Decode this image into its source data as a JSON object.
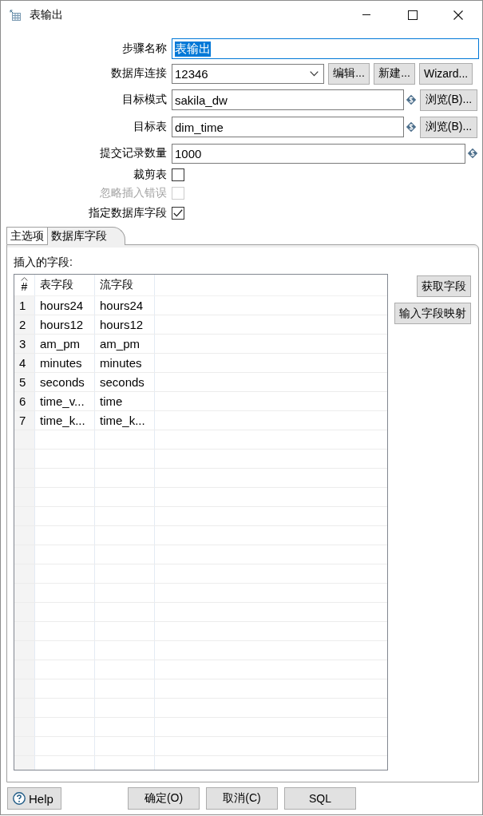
{
  "window": {
    "title": "表输出"
  },
  "form": {
    "fields": [
      {
        "kind": "text",
        "label": "步骤名称",
        "value": "表输出",
        "focused": true,
        "text_selected": true
      },
      {
        "kind": "combo",
        "label": "数据库连接",
        "value": "12346",
        "focused": false,
        "buttons": [
          {
            "label": "编辑..."
          },
          {
            "label": "新建..."
          },
          {
            "label": "Wizard..."
          }
        ]
      },
      {
        "kind": "text",
        "label": "目标模式",
        "value": "sakila_dw",
        "focused": false,
        "text_selected": false,
        "variable": true,
        "buttons": [
          {
            "label": "浏览(B)..."
          }
        ]
      },
      {
        "kind": "text",
        "label": "目标表",
        "value": "dim_time",
        "focused": false,
        "text_selected": false,
        "variable": true,
        "buttons": [
          {
            "label": "浏览(B)..."
          }
        ]
      },
      {
        "kind": "text",
        "label": "提交记录数量",
        "value": "1000",
        "focused": false,
        "text_selected": false,
        "variable": true
      },
      {
        "kind": "checkbox",
        "label": "裁剪表",
        "checked": false,
        "disabled": false
      },
      {
        "kind": "checkbox",
        "label": "忽略插入错误",
        "checked": false,
        "disabled": true
      },
      {
        "kind": "checkbox",
        "label": "指定数据库字段",
        "checked": true,
        "disabled": false
      }
    ]
  },
  "tabs": [
    {
      "label": "主选项",
      "selected": false
    },
    {
      "label": "数据库字段",
      "selected": true
    }
  ],
  "fields_panel": {
    "label": "插入的字段:",
    "table": {
      "columns": [
        {
          "label": "#",
          "sorted": true
        },
        {
          "label": "表字段",
          "sorted": false
        },
        {
          "label": "流字段",
          "sorted": false
        }
      ],
      "rows": [
        [
          "1",
          "hours24",
          "hours24"
        ],
        [
          "2",
          "hours12",
          "hours12"
        ],
        [
          "3",
          "am_pm",
          "am_pm"
        ],
        [
          "4",
          "minutes",
          "minutes"
        ],
        [
          "5",
          "seconds",
          "seconds"
        ],
        [
          "6",
          "time_v...",
          "time"
        ],
        [
          "7",
          "time_k...",
          "time_k..."
        ]
      ]
    },
    "buttons": [
      {
        "label": "获取字段"
      },
      {
        "label": "输入字段映射"
      }
    ]
  },
  "footer": {
    "help": {
      "label": "Help"
    },
    "buttons": [
      {
        "label": "确定(O)"
      },
      {
        "label": "取消(C)"
      },
      {
        "label": "SQL"
      }
    ]
  }
}
